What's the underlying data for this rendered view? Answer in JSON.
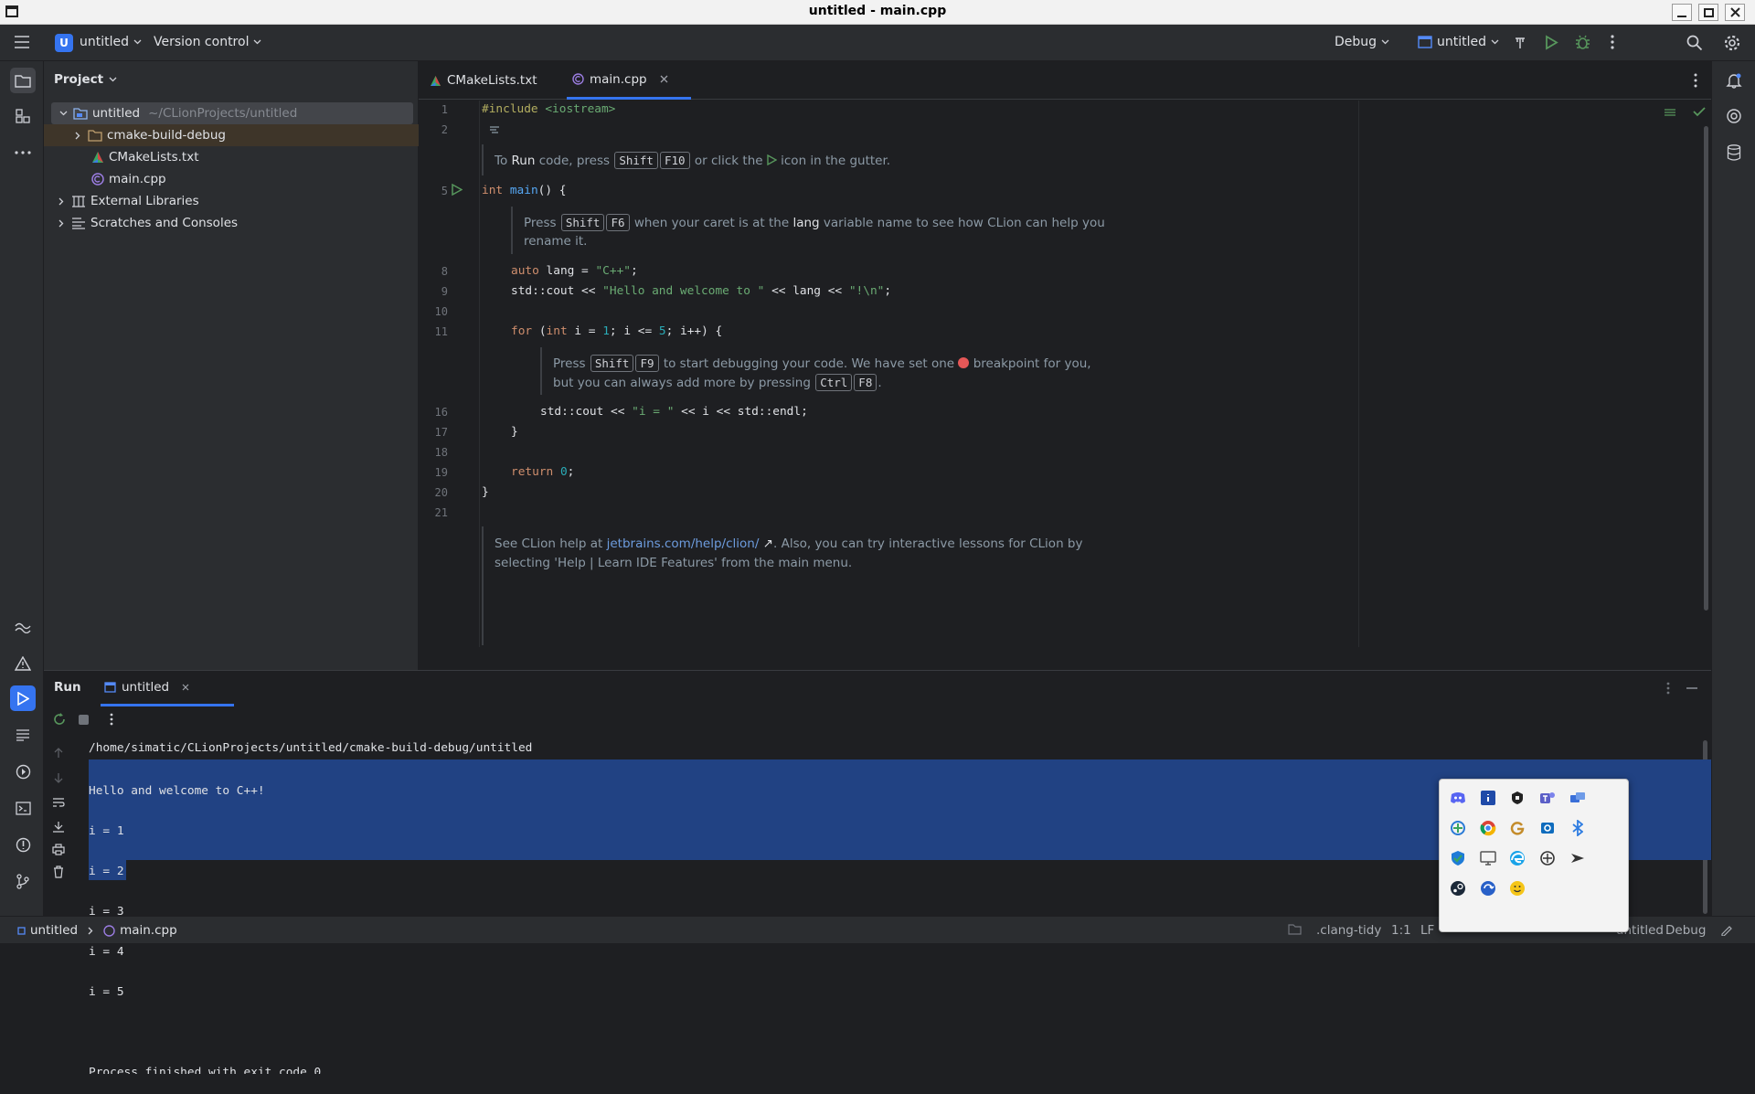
{
  "window": {
    "title": "untitled - main.cpp"
  },
  "toolbar": {
    "project_badge": "U",
    "project_name": "untitled",
    "version_control": "Version control",
    "build_config": "Debug",
    "run_target": "untitled"
  },
  "project_panel": {
    "title": "Project",
    "tree": [
      {
        "label": "untitled",
        "path": "~/CLionProjects/untitled"
      },
      {
        "label": "cmake-build-debug"
      },
      {
        "label": "CMakeLists.txt"
      },
      {
        "label": "main.cpp"
      },
      {
        "label": "External Libraries"
      },
      {
        "label": "Scratches and Consoles"
      }
    ]
  },
  "editor": {
    "tabs": [
      {
        "label": "CMakeLists.txt",
        "active": false
      },
      {
        "label": "main.cpp",
        "active": true
      }
    ],
    "line_numbers": [
      "1",
      "2",
      "5",
      "8",
      "9",
      "10",
      "11",
      "16",
      "17",
      "18",
      "19",
      "20",
      "21"
    ],
    "code": {
      "l1_pp": "#include",
      "l1_hdr": " <iostream>",
      "l5_int": "int",
      "l5_main": " main",
      "l5_rest": "() {",
      "l8_auto": "auto",
      "l8_rest": " lang = ",
      "l8_str": "\"C++\"",
      "l8_end": ";",
      "l9_a": "std::cout << ",
      "l9_str": "\"Hello and welcome to \"",
      "l9_b": " << lang << ",
      "l9_str2": "\"!\\n\"",
      "l9_end": ";",
      "l11_for": "for",
      "l11_a": " (",
      "l11_int": "int",
      "l11_b": " i = ",
      "l11_n1": "1",
      "l11_c": "; i <= ",
      "l11_n5": "5",
      "l11_d": "; i++) {",
      "l16_a": "std::cout << ",
      "l16_str": "\"i = \"",
      "l16_b": " << i << std::endl;",
      "l17": "}",
      "l19_ret": "return",
      "l19_sp": " ",
      "l19_n": "0",
      "l19_end": ";",
      "l20": "}"
    },
    "hints": {
      "run_a": "To ",
      "run_b": "Run",
      "run_c": " code, press ",
      "run_k1": "Shift",
      "run_k2": "F10",
      "run_d": " or click the ",
      "run_e": " icon in the gutter.",
      "ren_a": "Press ",
      "ren_k1": "Shift",
      "ren_k2": "F6",
      "ren_b": " when your caret is at the ",
      "ren_c": "lang",
      "ren_d": " variable name to see how CLion can help you",
      "ren_e": "rename it.",
      "dbg_a": "Press ",
      "dbg_k1": "Shift",
      "dbg_k2": "F9",
      "dbg_b": " to start debugging your code. We have set one ",
      "dbg_c": " breakpoint for you,",
      "dbg_d": "but you can always add more by pressing ",
      "dbg_k3": "Ctrl",
      "dbg_k4": "F8",
      "dbg_e": ".",
      "help_a": "See CLion help at ",
      "help_link": "jetbrains.com/help/clion/",
      "help_b": ". Also, you can try interactive lessons for CLion by",
      "help_c": "selecting 'Help | Learn IDE Features' from the main menu."
    }
  },
  "run_panel": {
    "title": "Run",
    "tab": "untitled",
    "console": [
      "/home/simatic/CLionProjects/untitled/cmake-build-debug/untitled",
      "Hello and welcome to C++!",
      "i = 1",
      "i = 2",
      "i = 3",
      "i = 4",
      "i = 5",
      "",
      "Process finished with exit code 0"
    ]
  },
  "statusbar": {
    "crumb_project": "untitled",
    "crumb_file": "main.cpp",
    "clang_tidy": ".clang-tidy",
    "position": "1:1",
    "line_sep": "LF",
    "run_target": "untitled",
    "config": "Debug"
  },
  "colors": {
    "accent": "#3574f0",
    "bg": "#1e1f22",
    "panel": "#2b2d30",
    "selection": "#214283"
  }
}
